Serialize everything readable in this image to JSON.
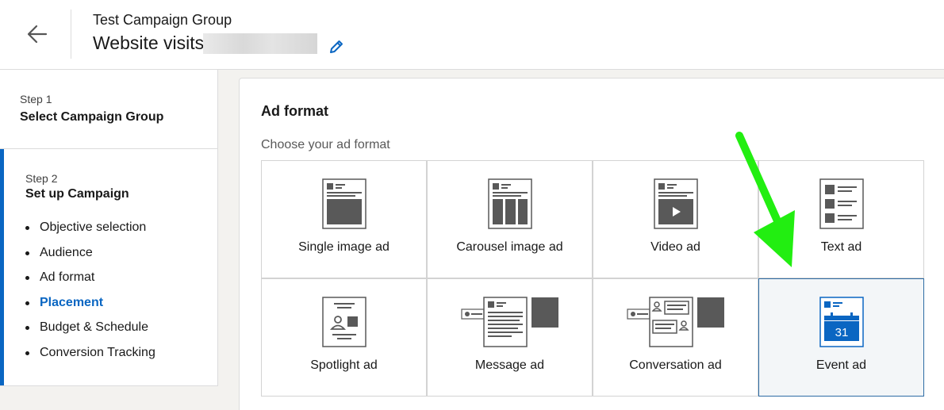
{
  "header": {
    "group_name": "Test Campaign Group",
    "campaign_title": "Website visits",
    "back_icon": "arrow-left-icon",
    "edit_icon": "pencil-icon"
  },
  "sidebar": {
    "step1": {
      "label": "Step 1",
      "title": "Select Campaign Group"
    },
    "step2": {
      "label": "Step 2",
      "title": "Set up Campaign",
      "items": [
        {
          "label": "Objective selection",
          "active": false
        },
        {
          "label": "Audience",
          "active": false
        },
        {
          "label": "Ad format",
          "active": false
        },
        {
          "label": "Placement",
          "active": true
        },
        {
          "label": "Budget & Schedule",
          "active": false
        },
        {
          "label": "Conversion Tracking",
          "active": false
        }
      ]
    }
  },
  "main": {
    "title": "Ad format",
    "subtitle": "Choose your ad format",
    "formats": [
      {
        "label": "Single image ad",
        "icon": "single-image-ad-icon"
      },
      {
        "label": "Carousel image ad",
        "icon": "carousel-image-ad-icon"
      },
      {
        "label": "Video ad",
        "icon": "video-ad-icon"
      },
      {
        "label": "Text ad",
        "icon": "text-ad-icon"
      },
      {
        "label": "Spotlight ad",
        "icon": "spotlight-ad-icon"
      },
      {
        "label": "Message ad",
        "icon": "message-ad-icon"
      },
      {
        "label": "Conversation ad",
        "icon": "conversation-ad-icon"
      },
      {
        "label": "Event ad",
        "icon": "event-ad-icon",
        "selected": true,
        "calendar_day": "31"
      }
    ]
  },
  "colors": {
    "accent": "#0a66c2",
    "annotation_arrow": "#22ee11",
    "selected_bg": "#f3f6f8"
  }
}
